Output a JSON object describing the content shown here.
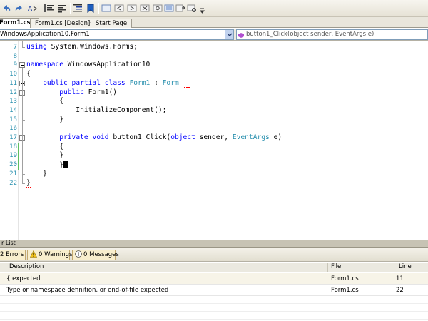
{
  "toolbar": {
    "icons": [
      "undo-icon",
      "redo-icon",
      "font-size-icon",
      "comment-icon",
      "uncomment-icon",
      "indent-icon",
      "bookmark-icon",
      "toggle-bookmark-icon",
      "prev-bookmark-icon",
      "next-bookmark-icon",
      "clear-bookmark-icon",
      "find-icon",
      "find-in-files-icon",
      "overflow-icon"
    ]
  },
  "tabs": [
    {
      "label": "Form1.cs*",
      "active": true
    },
    {
      "label": "Form1.cs [Design]*",
      "active": false
    },
    {
      "label": "Start Page",
      "active": false
    }
  ],
  "navbar": {
    "type_combo": "WindowsApplication10.Form1",
    "member_combo": "button1_Click(object sender, EventArgs e)"
  },
  "editor": {
    "lines": [
      {
        "n": "7",
        "tokens": [
          {
            "t": "using",
            "c": "kw"
          },
          {
            "t": " System.Windows.Forms;",
            "c": ""
          }
        ]
      },
      {
        "n": "8",
        "tokens": []
      },
      {
        "n": "9",
        "tokens": [
          {
            "t": "namespace",
            "c": "kw"
          },
          {
            "t": " WindowsApplication10",
            "c": ""
          }
        ]
      },
      {
        "n": "10",
        "tokens": [
          {
            "t": "{",
            "c": ""
          }
        ]
      },
      {
        "n": "11",
        "tokens": [
          {
            "t": "    ",
            "c": ""
          },
          {
            "t": "public",
            "c": "kw"
          },
          {
            "t": " ",
            "c": ""
          },
          {
            "t": "partial",
            "c": "kw"
          },
          {
            "t": " ",
            "c": ""
          },
          {
            "t": "class",
            "c": "kw"
          },
          {
            "t": " ",
            "c": ""
          },
          {
            "t": "Form1",
            "c": "ty"
          },
          {
            "t": " : ",
            "c": ""
          },
          {
            "t": "Form",
            "c": "ty"
          }
        ]
      },
      {
        "n": "12",
        "tokens": [
          {
            "t": "        ",
            "c": ""
          },
          {
            "t": "public",
            "c": "kw"
          },
          {
            "t": " Form1()",
            "c": ""
          }
        ]
      },
      {
        "n": "13",
        "tokens": [
          {
            "t": "        {",
            "c": ""
          }
        ]
      },
      {
        "n": "14",
        "tokens": [
          {
            "t": "            InitializeComponent();",
            "c": ""
          }
        ]
      },
      {
        "n": "15",
        "tokens": [
          {
            "t": "        }",
            "c": ""
          }
        ]
      },
      {
        "n": "16",
        "tokens": []
      },
      {
        "n": "17",
        "tokens": [
          {
            "t": "        ",
            "c": ""
          },
          {
            "t": "private",
            "c": "kw"
          },
          {
            "t": " ",
            "c": ""
          },
          {
            "t": "void",
            "c": "kw"
          },
          {
            "t": " button1_Click(",
            "c": ""
          },
          {
            "t": "object",
            "c": "kw"
          },
          {
            "t": " sender, ",
            "c": ""
          },
          {
            "t": "EventArgs",
            "c": "ty"
          },
          {
            "t": " e)",
            "c": ""
          }
        ]
      },
      {
        "n": "18",
        "tokens": [
          {
            "t": "        {",
            "c": ""
          }
        ]
      },
      {
        "n": "19",
        "tokens": [
          {
            "t": "        }",
            "c": ""
          }
        ]
      },
      {
        "n": "20",
        "tokens": [
          {
            "t": "        }",
            "c": ""
          }
        ]
      },
      {
        "n": "21",
        "tokens": [
          {
            "t": "    }",
            "c": ""
          }
        ]
      },
      {
        "n": "22",
        "tokens": [
          {
            "t": "}",
            "c": ""
          }
        ]
      }
    ],
    "changed_lines": [
      "18",
      "19",
      "20"
    ],
    "caret_line": "20"
  },
  "error_list": {
    "title": "r List",
    "filters": {
      "errors": "2 Errors",
      "warnings": "0 Warnings",
      "messages": "0 Messages"
    },
    "columns": {
      "description": "Description",
      "file": "File",
      "line": "Line"
    },
    "rows": [
      {
        "description": "{ expected",
        "file": "Form1.cs",
        "line": "11"
      },
      {
        "description": "Type or namespace definition, or end-of-file expected",
        "file": "Form1.cs",
        "line": "22"
      }
    ]
  },
  "colors": {
    "keyword": "#0000ff",
    "type": "#2b91af",
    "line_number": "#2b91af",
    "changed_marker": "#5fbf5f",
    "error_squiggle": "#ff0000"
  }
}
